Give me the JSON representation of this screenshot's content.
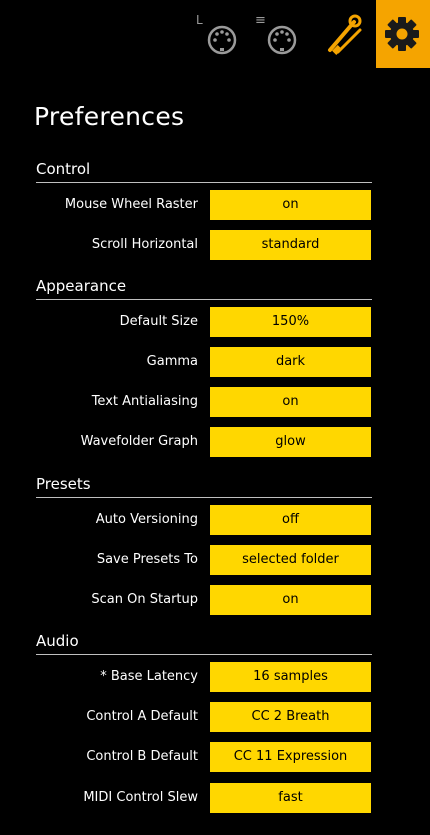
{
  "topbar": {
    "icons": [
      {
        "name": "midi-port-l-icon",
        "letter": "L"
      },
      {
        "name": "midi-port-e-icon",
        "letter": "≡"
      },
      {
        "name": "tools-icon"
      },
      {
        "name": "gear-icon"
      }
    ],
    "accent_color": "#f5a400",
    "icon_color": "#9a9a9a"
  },
  "title": "Preferences",
  "colors": {
    "value_bg": "#ffd700",
    "value_text": "#000000",
    "background": "#000000"
  },
  "sections": [
    {
      "title": "Control",
      "rows": [
        {
          "label": "Mouse Wheel Raster",
          "value": "on"
        },
        {
          "label": "Scroll Horizontal",
          "value": "standard"
        }
      ]
    },
    {
      "title": "Appearance",
      "rows": [
        {
          "label": "Default Size",
          "value": "150%"
        },
        {
          "label": "Gamma",
          "value": "dark"
        },
        {
          "label": "Text Antialiasing",
          "value": "on"
        },
        {
          "label": "Wavefolder Graph",
          "value": "glow"
        }
      ]
    },
    {
      "title": "Presets",
      "rows": [
        {
          "label": "Auto Versioning",
          "value": "off"
        },
        {
          "label": "Save Presets To",
          "value": "selected folder"
        },
        {
          "label": "Scan On Startup",
          "value": "on"
        }
      ]
    },
    {
      "title": "Audio",
      "rows": [
        {
          "label": "* Base Latency",
          "value": "16 samples"
        },
        {
          "label": "Control A Default",
          "value": "CC 2 Breath"
        },
        {
          "label": "Control B Default",
          "value": "CC 11 Expression"
        },
        {
          "label": "MIDI Control Slew",
          "value": "fast"
        }
      ]
    }
  ]
}
